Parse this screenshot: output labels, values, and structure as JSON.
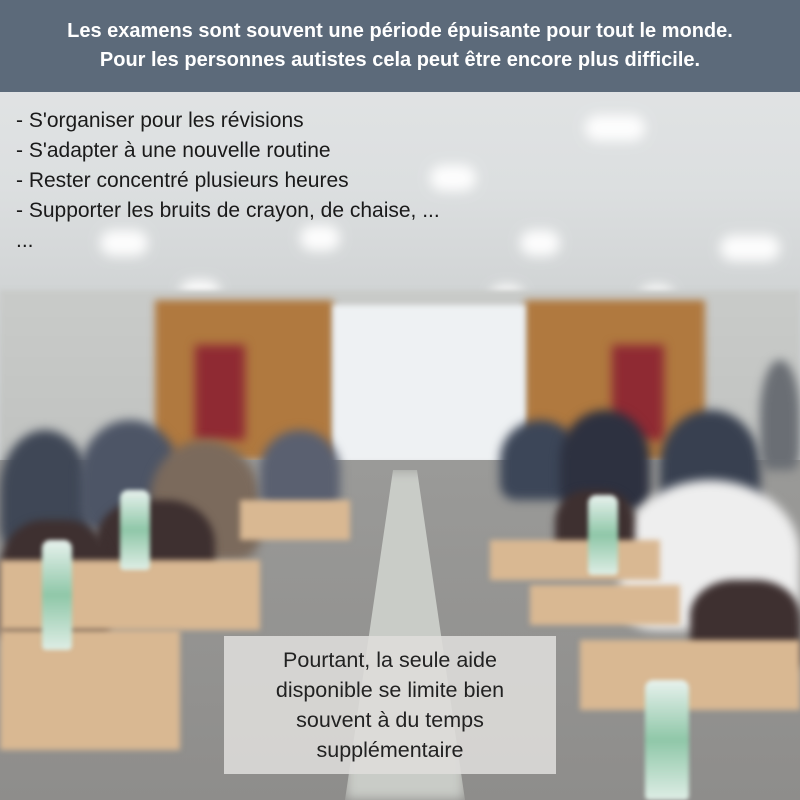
{
  "header": {
    "line1": "Les examens sont souvent une période épuisante pour tout le monde.",
    "line2": "Pour les personnes autistes cela peut être encore plus difficile."
  },
  "bullets": [
    "- S'organiser pour les révisions",
    "- S'adapter à une nouvelle routine",
    "- Rester concentré plusieurs heures",
    "- Supporter les bruits de crayon, de chaise, ...",
    "..."
  ],
  "callout": {
    "line1": "Pourtant, la seule aide",
    "line2": "disponible se limite bien",
    "line3": "souvent à du temps",
    "line4": "supplémentaire"
  },
  "colors": {
    "banner_bg": "#5c6a7a",
    "banner_text": "#ffffff",
    "callout_bg": "#dedddb"
  }
}
